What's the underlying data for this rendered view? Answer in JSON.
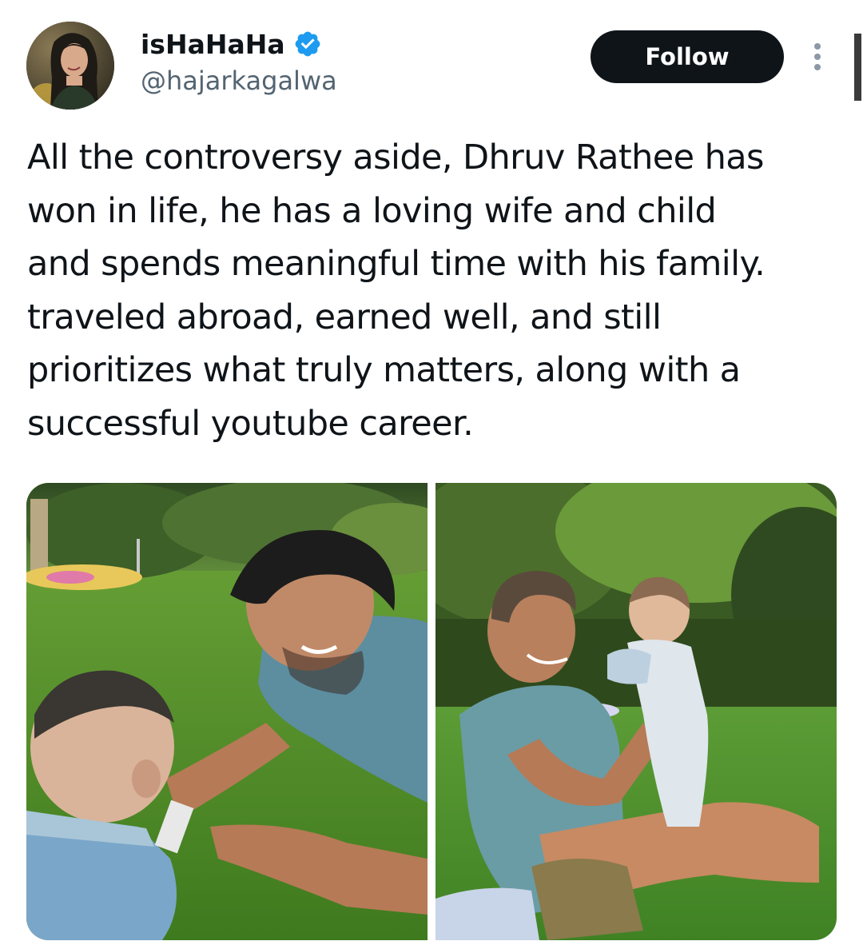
{
  "author": {
    "display_name": "isHaHaHa",
    "handle": "@hajarkagalwa",
    "verified": true
  },
  "actions": {
    "follow_label": "Follow",
    "more_icon": "more-vertical-icon"
  },
  "tweet": {
    "text": "All the controversy aside, Dhruv Rathee has\nwon in life, he has a loving wife and child\nand spends meaningful time with his family.\ntraveled abroad, earned well, and still\nprioritizes what truly matters, along with a\nsuccessful youtube career."
  },
  "media": {
    "photos": [
      {
        "description_icon": "photo-man-lying-on-grass-with-baby"
      },
      {
        "description_icon": "photo-man-holding-baby-on-grass"
      }
    ]
  },
  "colors": {
    "text": "#0f1419",
    "secondary_text": "#536471",
    "verified_badge": "#1d9bf0",
    "follow_button_bg": "#0f1419",
    "follow_button_text": "#ffffff"
  }
}
